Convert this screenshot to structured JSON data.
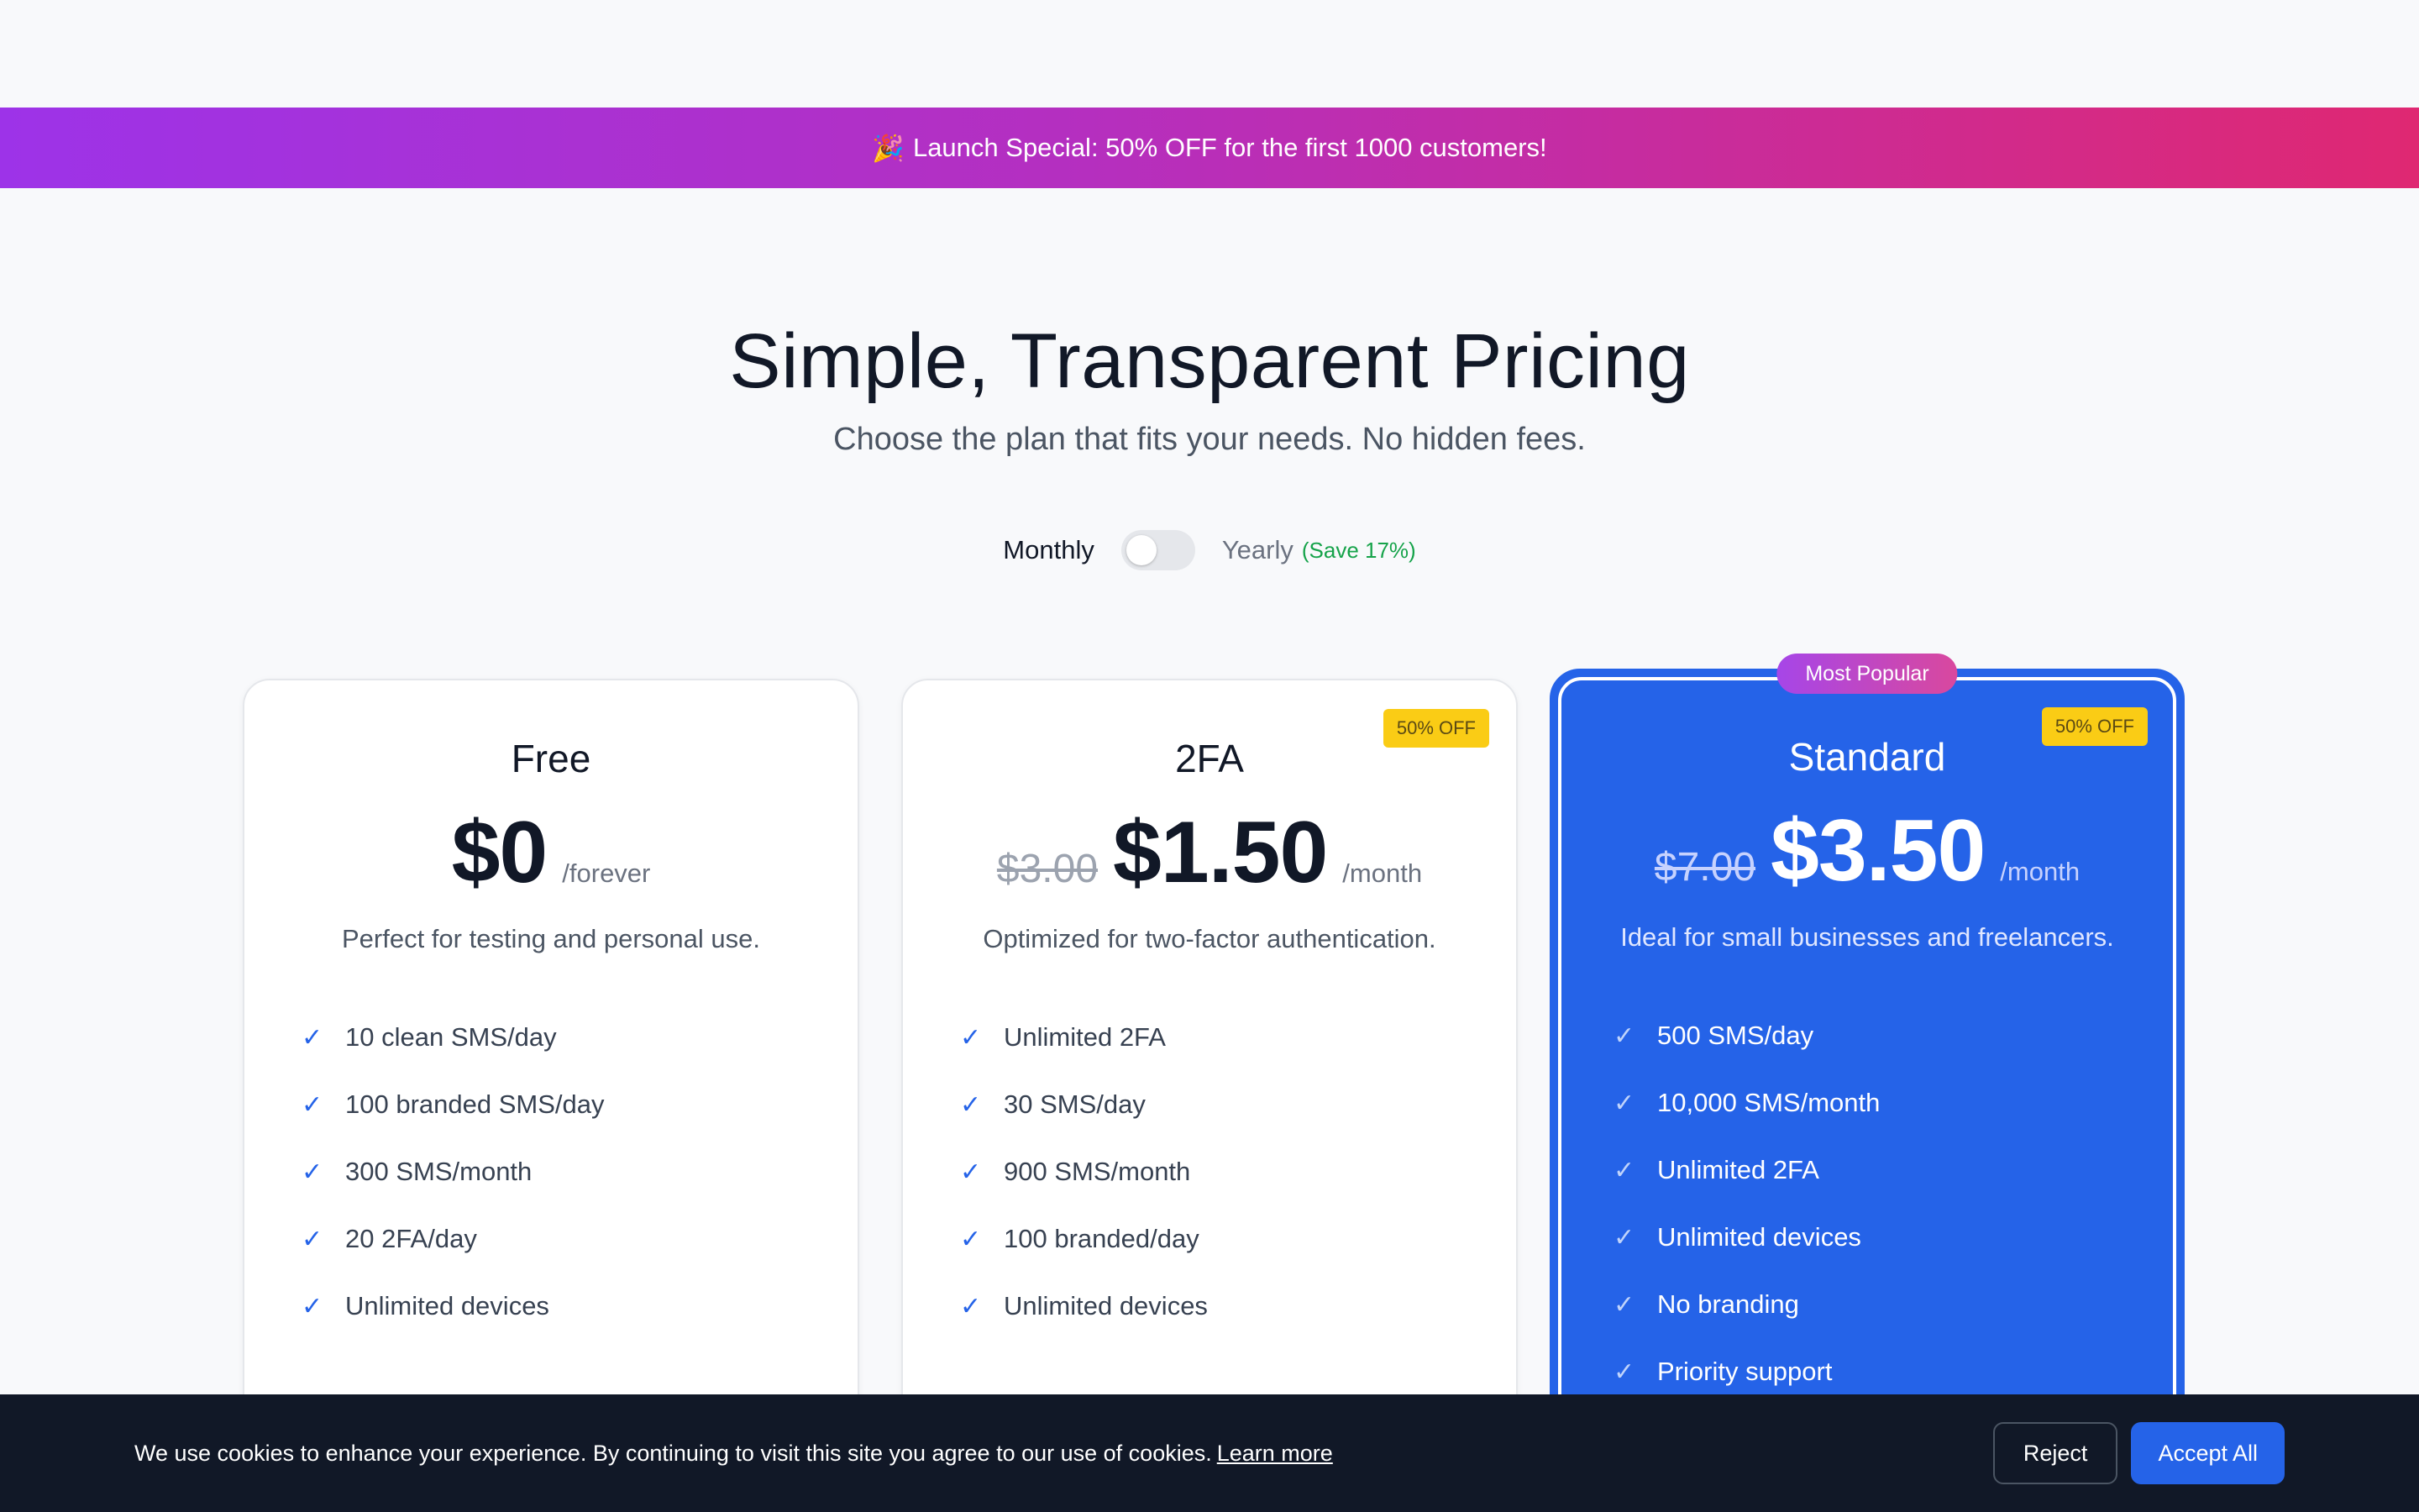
{
  "promo": {
    "emoji": "🎉",
    "text": "Launch Special: 50% OFF for the first 1000 customers!"
  },
  "hero": {
    "title": "Simple, Transparent Pricing",
    "subtitle": "Choose the plan that fits your needs. No hidden fees."
  },
  "billing": {
    "monthly_label": "Monthly",
    "yearly_label": "Yearly",
    "save_note": "(Save 17%)",
    "yearly_selected": false
  },
  "plans": [
    {
      "name": "Free",
      "price": "$0",
      "period": "/forever",
      "description": "Perfect for testing and personal use.",
      "features": [
        "10 clean SMS/day",
        "100 branded SMS/day",
        "300 SMS/month",
        "20 2FA/day",
        "Unlimited devices"
      ]
    },
    {
      "name": "2FA",
      "badge": "50% OFF",
      "old_price": "$3.00",
      "price": "$1.50",
      "period": "/month",
      "description": "Optimized for two-factor authentication.",
      "features": [
        "Unlimited 2FA",
        "30 SMS/day",
        "900 SMS/month",
        "100 branded/day",
        "Unlimited devices"
      ]
    },
    {
      "name": "Standard",
      "popular_label": "Most Popular",
      "badge": "50% OFF",
      "old_price": "$7.00",
      "price": "$3.50",
      "period": "/month",
      "description": "Ideal for small businesses and freelancers.",
      "features": [
        "500 SMS/day",
        "10,000 SMS/month",
        "Unlimited 2FA",
        "Unlimited devices",
        "No branding",
        "Priority support"
      ]
    }
  ],
  "check_glyph": "✓",
  "cookie": {
    "text": "We use cookies to enhance your experience. By continuing to visit this site you agree to our use of cookies.",
    "learn_more": "Learn more",
    "reject_label": "Reject",
    "accept_label": "Accept All"
  },
  "colors": {
    "accent": "#2563e8",
    "banner_start": "#9d33e8",
    "banner_end": "#df2872",
    "save_green": "#16a34a",
    "badge_yellow": "#facc15",
    "cookie_bg": "#111827"
  }
}
